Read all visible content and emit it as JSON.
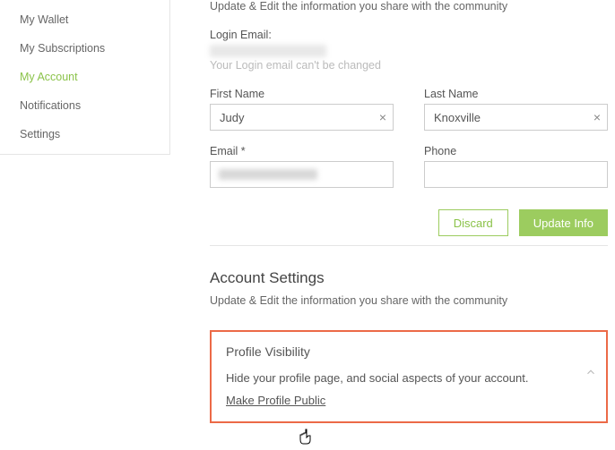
{
  "sidebar": {
    "items": [
      {
        "label": "My Wallet"
      },
      {
        "label": "My Subscriptions"
      },
      {
        "label": "My Account"
      },
      {
        "label": "Notifications"
      },
      {
        "label": "Settings"
      }
    ]
  },
  "profile": {
    "update_blurb": "Update & Edit the information you share with the community",
    "login_email_label": "Login Email:",
    "login_email_hint": "Your Login email can't be changed",
    "first_name_label": "First Name",
    "first_name_value": "Judy",
    "last_name_label": "Last Name",
    "last_name_value": "Knoxville",
    "email_label": "Email *",
    "phone_label": "Phone",
    "discard_btn": "Discard",
    "update_btn": "Update Info"
  },
  "account": {
    "title": "Account Settings",
    "blurb": "Update & Edit the information you share with the community"
  },
  "visibility": {
    "title": "Profile Visibility",
    "desc": "Hide your profile page, and social aspects of your account.",
    "link": "Make Profile Public"
  }
}
